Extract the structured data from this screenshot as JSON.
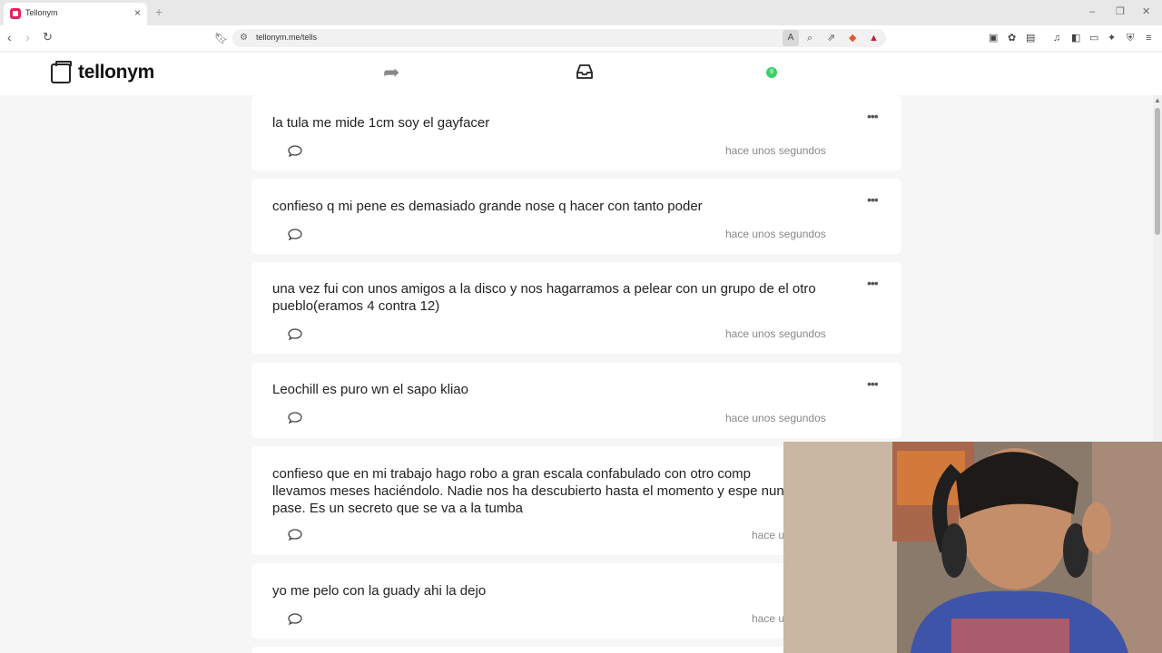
{
  "browser": {
    "tab_title": "Tellonym",
    "url": "tellonym.me/tells",
    "new_tab": "+",
    "close": "×"
  },
  "site": {
    "logo_text": "tellonym",
    "notification_count": "9"
  },
  "tells": [
    {
      "text": "la tula me mide 1cm soy el gayfacer",
      "time": "hace unos segundos"
    },
    {
      "text": "confieso q mi pene es demasiado grande nose q hacer con tanto poder",
      "time": "hace unos segundos"
    },
    {
      "text": "una vez fui con unos amigos a la disco y nos hagarramos a pelear con un grupo de el otro pueblo(eramos 4 contra 12)",
      "time": "hace unos segundos"
    },
    {
      "text": "Leochill es puro wn el sapo kliao",
      "time": "hace unos segundos"
    },
    {
      "text": "confieso que en mi trabajo hago robo a gran escala confabulado con otro comp llevamos meses haciéndolo. Nadie nos ha descubierto hasta el momento y espe nunca pase. Es un secreto que se va a la tumba",
      "time": "hace u"
    },
    {
      "text": "yo me pelo con la guady ahi la dejo",
      "time": "hace u"
    }
  ],
  "menu_glyph": "•••",
  "colors": {
    "brand": "#e3245a",
    "online": "#3fcf6a",
    "background": "#f6f6f6"
  }
}
